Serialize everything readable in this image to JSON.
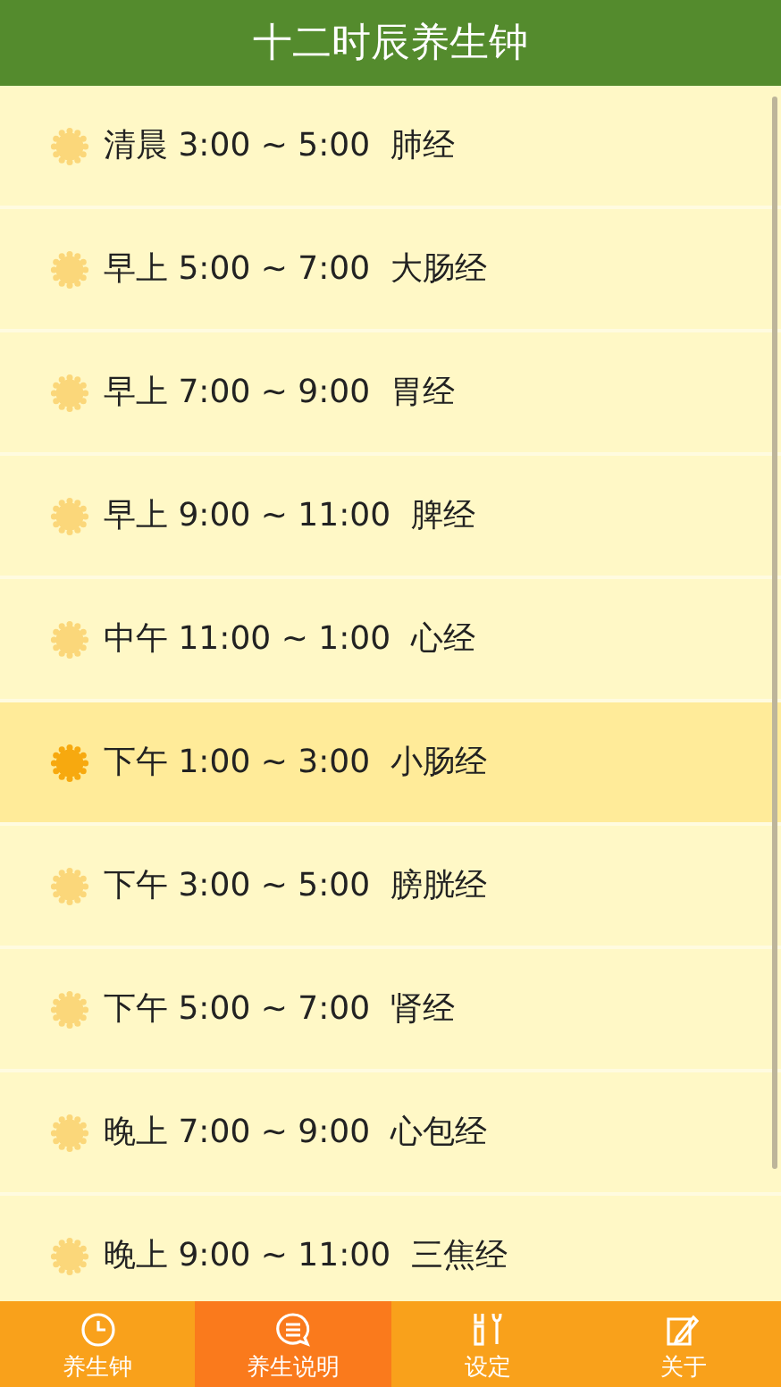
{
  "title": "十二时辰养生钟",
  "periods": [
    {
      "label": "清晨 3:00 ~ 5:00  肺经",
      "selected": false
    },
    {
      "label": "早上 5:00 ~ 7:00  大肠经",
      "selected": false
    },
    {
      "label": "早上 7:00 ~ 9:00  胃经",
      "selected": false
    },
    {
      "label": "早上 9:00 ~ 11:00  脾经",
      "selected": false
    },
    {
      "label": "中午 11:00 ~ 1:00  心经",
      "selected": false
    },
    {
      "label": "下午 1:00 ~ 3:00  小肠经",
      "selected": true
    },
    {
      "label": "下午 3:00 ~ 5:00  膀胱经",
      "selected": false
    },
    {
      "label": "下午 5:00 ~ 7:00  肾经",
      "selected": false
    },
    {
      "label": "晚上 7:00 ~ 9:00  心包经",
      "selected": false
    },
    {
      "label": "晚上 9:00 ~ 11:00  三焦经",
      "selected": false
    }
  ],
  "tabs": [
    {
      "label": "养生钟",
      "kind": "clock",
      "selected": false
    },
    {
      "label": "养生说明",
      "kind": "chat",
      "selected": true
    },
    {
      "label": "设定",
      "kind": "tools",
      "selected": false
    },
    {
      "label": "关于",
      "kind": "note",
      "selected": false
    }
  ]
}
